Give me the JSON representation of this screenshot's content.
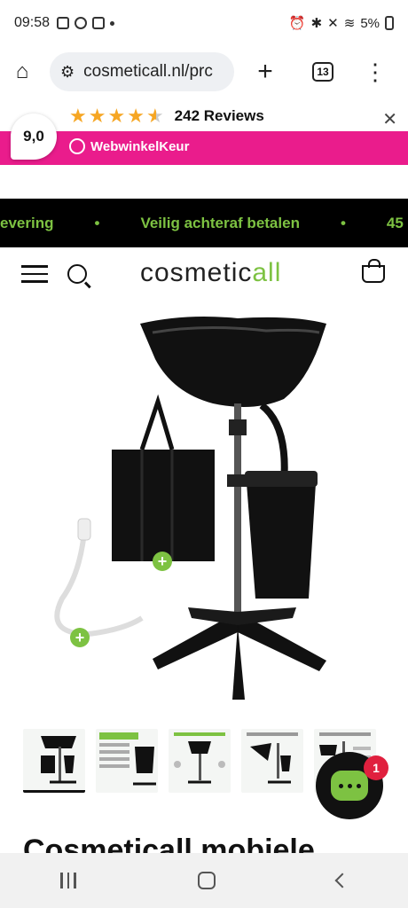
{
  "status_bar": {
    "time": "09:58",
    "battery": "5%"
  },
  "browser": {
    "url": "cosmeticall.nl/prc",
    "tab_count": "13"
  },
  "reviews": {
    "score": "9,0",
    "rating_stars": 4.5,
    "count_label": "242 Reviews",
    "provider": "WebwinkelKeur"
  },
  "promo": {
    "items": [
      "evering",
      "Veilig achteraf betalen",
      "45"
    ]
  },
  "header": {
    "brand_left": "cos",
    "brand_mid": "metic",
    "brand_right": "all"
  },
  "product": {
    "title": "Cosmeticall mobiele"
  },
  "chat": {
    "badge_count": "1"
  },
  "colors": {
    "accent_green": "#7dc242",
    "pink": "#ea1c8c",
    "promo_bg": "#000000"
  }
}
